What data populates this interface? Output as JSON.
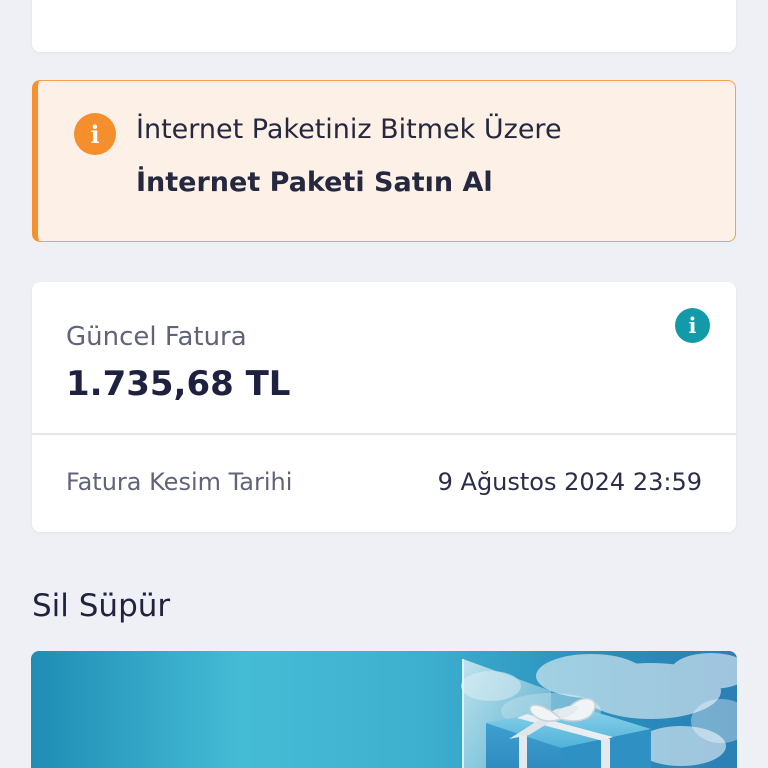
{
  "alert": {
    "icon": "info-icon",
    "title": "İnternet Paketiniz Bitmek Üzere",
    "action_label": "İnternet Paketi Satın Al",
    "accent_color": "#f7902e",
    "background_color": "#fdf0e6"
  },
  "bill": {
    "icon": "info-icon",
    "label": "Güncel Fatura",
    "amount": "1.735,68 TL",
    "cutoff_label": "Fatura Kesim Tarihi",
    "cutoff_date": "9 Ağustos 2024 23:59",
    "accent_color": "#139aa8"
  },
  "section": {
    "title": "Sil Süpür"
  },
  "banner": {
    "image": "gift-box-image"
  }
}
